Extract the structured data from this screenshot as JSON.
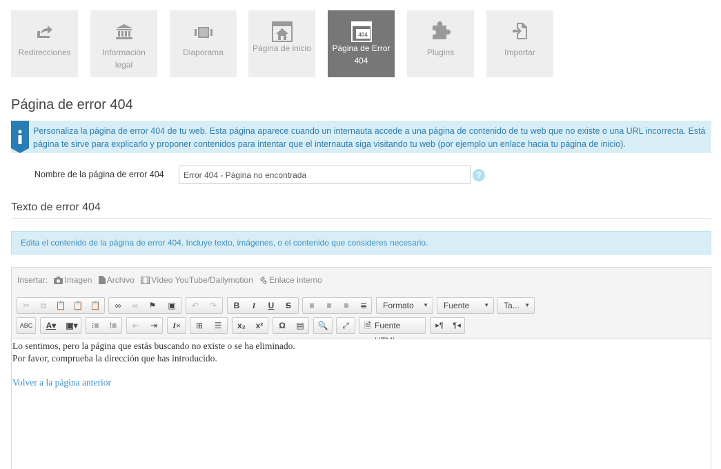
{
  "tiles": [
    {
      "label": "Redirecciones",
      "icon": "share-icon"
    },
    {
      "label": "Información legal",
      "icon": "institution-icon"
    },
    {
      "label": "Diaporama",
      "icon": "slideshow-icon"
    },
    {
      "label": "Página de inicio",
      "icon": "home-page-icon"
    },
    {
      "label": "Página de Error 404",
      "icon": "error-404-icon",
      "active": true
    },
    {
      "label": "Plugins",
      "icon": "puzzle-icon"
    },
    {
      "label": "Importar",
      "icon": "import-icon"
    }
  ],
  "page": {
    "title": "Página de error 404"
  },
  "info": {
    "text": "Personaliza la página de error 404 de tu web. Esta página aparece cuando un internauta accede a una página de contenido de tu web que no existe o una URL incorrecta. Está página te sirve para explicarlo y proponer contenidos para intentar que el internauta siga visitando tu web (por ejemplo un enlace hacia tu página de inicio)."
  },
  "form": {
    "label": "Nombre de la página de error 404",
    "value": "Error 404 - Página no encontrada",
    "help": "?"
  },
  "section": {
    "title": "Texto de error 404",
    "hint": "Edita el contenido de la página de error 404. Incluye texto, imágenes, o el contenido que consideres necesario."
  },
  "editor": {
    "insert_label": "Insertar:",
    "insert_items": [
      "Imagen",
      "Archivo",
      "Vídeo YouTube/Dailymotion",
      "Enlace interno"
    ],
    "format_label": "Formato",
    "font_label": "Fuente",
    "size_label": "Ta...",
    "source_label": "Fuente HTML",
    "bold": "B",
    "italic": "I",
    "underline": "U",
    "strike": "S",
    "subscript": "x₂",
    "superscript": "x²",
    "omega": "Ω",
    "ltr": "▸¶",
    "rtl": "¶◂",
    "content_line1": "Lo sentimos, pero la página que estás buscando no existe o se ha eliminado.",
    "content_line2": "Por favor, comprueba la dirección que has introducido.",
    "content_link": "Volver a la página anterior"
  },
  "colors": {
    "accent": "#2b7cb3",
    "info_bg": "#d8eef6",
    "tile_bg": "#eeeeee",
    "tile_active": "#777777"
  }
}
